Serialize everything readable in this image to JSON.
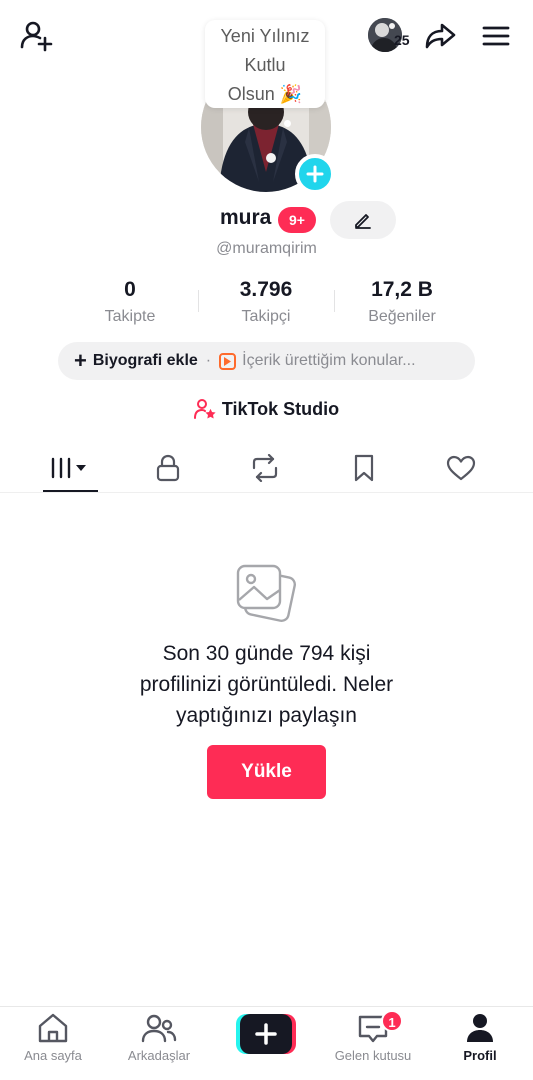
{
  "story": {
    "count": "25"
  },
  "profile": {
    "new_year_note": [
      "Yeni Yılınız",
      "Kutlu",
      "Olsun 🎉"
    ],
    "username": "mura",
    "badge": "9+",
    "handle": "@muramqirim"
  },
  "stats": [
    {
      "value": "0",
      "label": "Takipte"
    },
    {
      "value": "3.796",
      "label": "Takipçi"
    },
    {
      "value": "17,2 B",
      "label": "Beğeniler"
    }
  ],
  "bio": {
    "add_label": "Biyografi ekle",
    "separator": "·",
    "topic_placeholder": "İçerik ürettiğim konular..."
  },
  "studio": {
    "label": "TikTok Studio"
  },
  "tabs": [
    {
      "name": "videos-tab",
      "icon": "grid-icon"
    },
    {
      "name": "private-tab",
      "icon": "lock-icon"
    },
    {
      "name": "reposts-tab",
      "icon": "repost-icon"
    },
    {
      "name": "saved-tab",
      "icon": "bookmark-icon"
    },
    {
      "name": "liked-tab",
      "icon": "heart-icon"
    }
  ],
  "empty_state": {
    "line1": "Son 30 günde 794 kişi",
    "line2": "profilinizi görüntüledi. Neler",
    "line3": "yaptığınızı paylaşın",
    "upload_label": "Yükle"
  },
  "bottom_nav": {
    "home": "Ana sayfa",
    "friends": "Arkadaşlar",
    "inbox": "Gelen kutusu",
    "inbox_badge": "1",
    "profile": "Profil"
  },
  "colors": {
    "accent": "#fe2c55",
    "plus_badge": "#20d5ec",
    "secondary_text": "#8a8b91"
  }
}
